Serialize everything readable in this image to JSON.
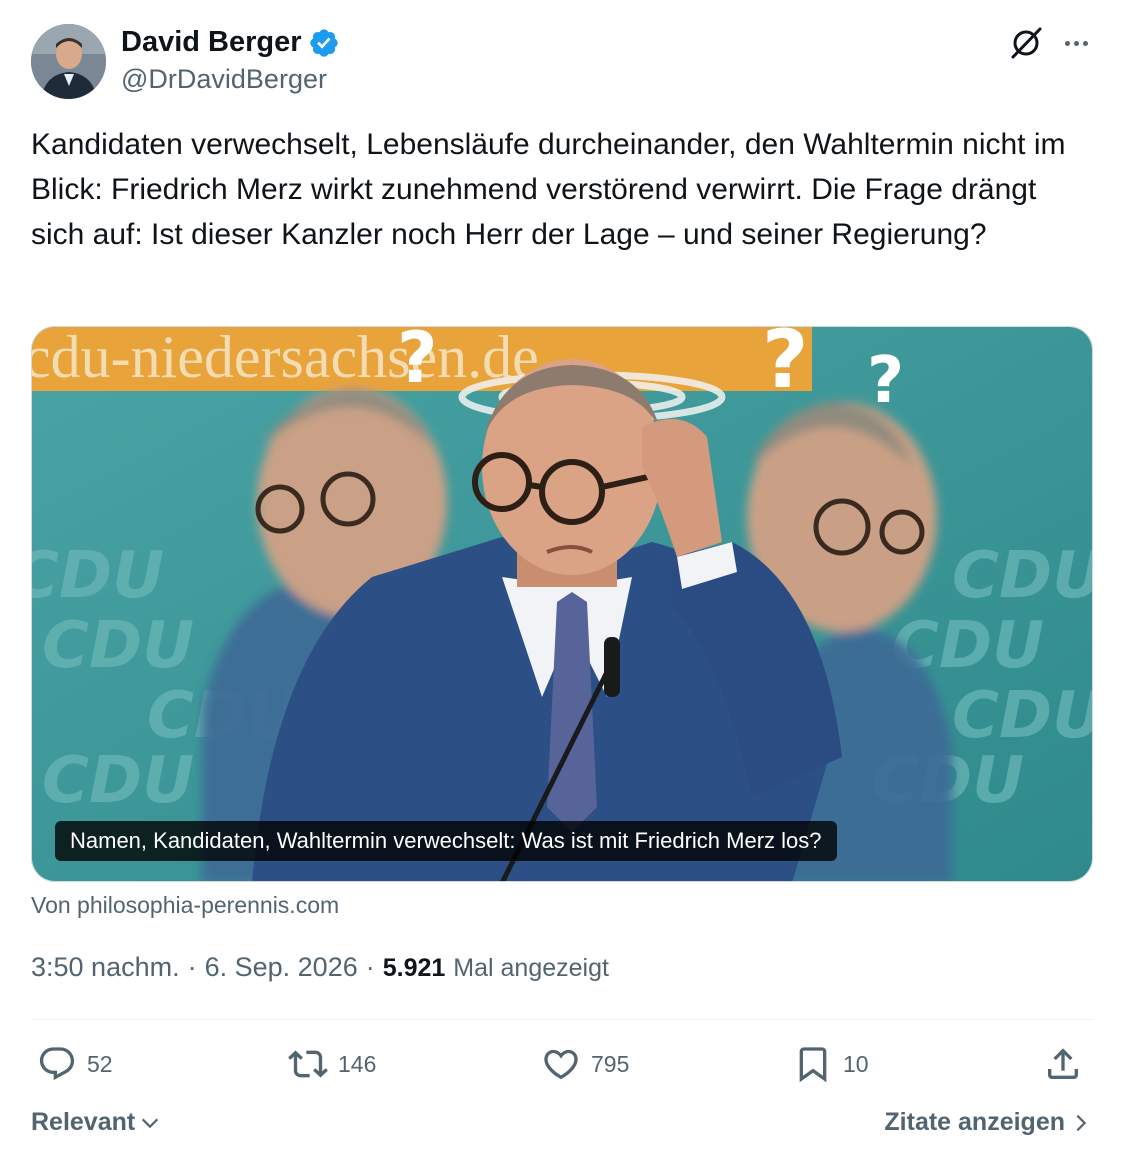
{
  "author": {
    "display_name": "David Berger",
    "handle": "@DrDavidBerger",
    "verified": true
  },
  "icons": {
    "verified": "verified-badge-icon",
    "grok": "grok-icon",
    "more": "more-icon",
    "reply": "reply-icon",
    "retweet": "retweet-icon",
    "like": "heart-icon",
    "bookmark": "bookmark-icon",
    "share": "share-icon",
    "chevron_down": "chevron-down-icon",
    "chevron_right": "chevron-right-icon"
  },
  "tweet": {
    "text": "Kandidaten verwechselt, Lebensläufe durcheinander, den Wahltermin nicht im Blick: Friedrich Merz wirkt zunehmend verstörend verwirrt. Die Frage drängt sich auf: Ist dieser Kanzler noch Herr der Lage – und seiner Regierung?"
  },
  "card": {
    "banner_text": "cdu-niedersachsen.de",
    "logo_text": "CDU",
    "caption": "Namen, Kandidaten, Wahltermin verwechselt: Was ist mit Friedrich Merz los?",
    "source": "Von philosophia-perennis.com"
  },
  "meta": {
    "time": "3:50 nachm.",
    "separator": "·",
    "date": "6. Sep. 2026",
    "views_count": "5.921",
    "views_label": "Mal angezeigt"
  },
  "actions": {
    "replies": "52",
    "retweets": "146",
    "likes": "795",
    "bookmarks": "10"
  },
  "footer": {
    "sort_label": "Relevant",
    "quotes_label": "Zitate anzeigen"
  },
  "colors": {
    "text_primary": "#0f1419",
    "text_secondary": "#536471",
    "verified_blue": "#1d9bf0",
    "photo_teal": "#3e9a9c",
    "banner_orange": "#e8a33a",
    "suit_blue": "#2c4f86"
  }
}
